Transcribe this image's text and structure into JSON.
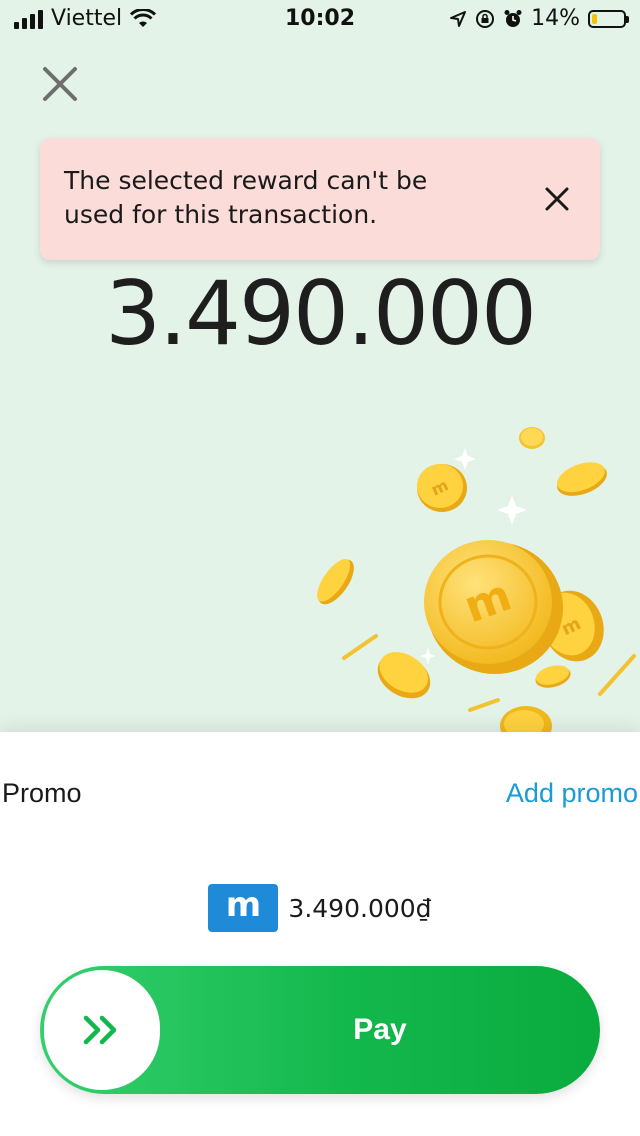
{
  "status_bar": {
    "carrier": "Viettel",
    "time": "10:02",
    "battery": "14%"
  },
  "toast": {
    "message": "The selected reward can't be used for this transaction."
  },
  "payment": {
    "amount": "3.490.000"
  },
  "sheet": {
    "promo_label": "Promo",
    "add_promo": "Add promo",
    "wallet_badge": "m",
    "wallet_amount": "3.490.000₫",
    "pay_label": "Pay"
  },
  "colors": {
    "background": "#e3f3e8",
    "toast": "#fcdcd8",
    "accent_blue": "#1a9bd7",
    "pay_green": "#13b84c",
    "wallet_blue": "#1f8ad8"
  }
}
